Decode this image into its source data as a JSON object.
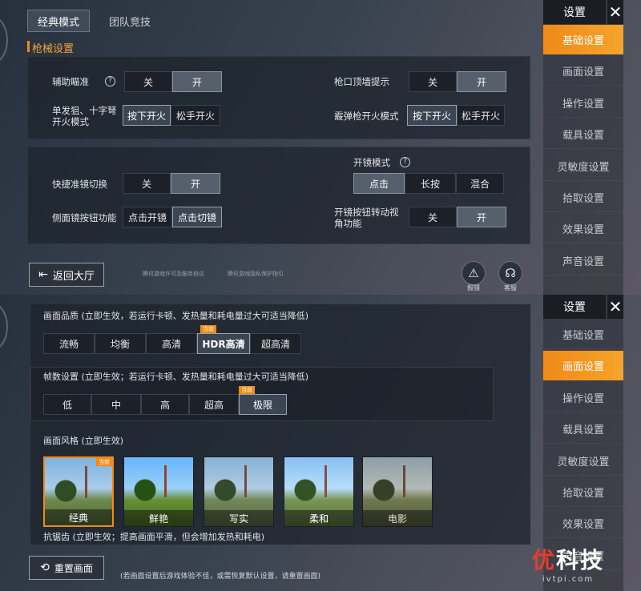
{
  "top": {
    "tabs": [
      "经典模式",
      "团队竞技"
    ],
    "section": "枪械设置",
    "settings": {
      "aim_assist": {
        "label": "辅助瞄准",
        "options": [
          "关",
          "开"
        ]
      },
      "muzzle_hint": {
        "label": "枪口顶墙提示",
        "options": [
          "关",
          "开"
        ]
      },
      "single_fire": {
        "label": "单发狙、十字弩开火模式",
        "options": [
          "按下开火",
          "松手开火"
        ]
      },
      "shotgun_fire": {
        "label": "霰弹枪开火模式",
        "options": [
          "按下开火",
          "松手开火"
        ]
      },
      "quick_scope": {
        "label": "快捷准镜切换",
        "options": [
          "关",
          "开"
        ]
      },
      "scope_mode": {
        "label": "开镜模式",
        "options": [
          "点击",
          "长按",
          "混合"
        ]
      },
      "side_scope": {
        "label": "侧面镜按钮功能",
        "options": [
          "点击开镜",
          "点击切镜"
        ]
      },
      "scope_turn": {
        "label": "开镜按钮转动视角功能",
        "options": [
          "关",
          "开"
        ]
      }
    },
    "back_label": "返回大厅",
    "links": [
      "腾讯游戏许可及服务协议",
      "腾讯游戏隐私保护指引"
    ],
    "report_label": "报错",
    "service_label": "客服"
  },
  "sidebar_title": "设置",
  "sidebar_items": [
    "基础设置",
    "画面设置",
    "操作设置",
    "载具设置",
    "灵敏度设置",
    "拾取设置",
    "效果设置",
    "声音设置"
  ],
  "bottom": {
    "quality_label": "画面品质 (立即生效，若运行卡顿、发热量和耗电量过大可适当降低)",
    "quality_options": [
      "流畅",
      "均衡",
      "高清",
      "HDR高清",
      "超高清"
    ],
    "current_badge": "当前",
    "fps_label": "帧数设置 (立即生效；若运行卡顿、发热量和耗电量过大可适当降低)",
    "fps_options": [
      "低",
      "中",
      "高",
      "超高",
      "极限"
    ],
    "style_label": "画面风格 (立即生效)",
    "styles": [
      "经典",
      "鲜艳",
      "写实",
      "柔和",
      "电影"
    ],
    "aa_label": "抗锯齿 (立即生效；提高画面平滑，但会增加发热和耗电)",
    "reset_label": "重置画面",
    "reset_note": "(若画面设置后游戏体验不佳，或需恢复默认设置，请重置画面)"
  },
  "watermark": {
    "brand_left": "优",
    "brand_right": "科技",
    "url": "ivtpi.com"
  }
}
